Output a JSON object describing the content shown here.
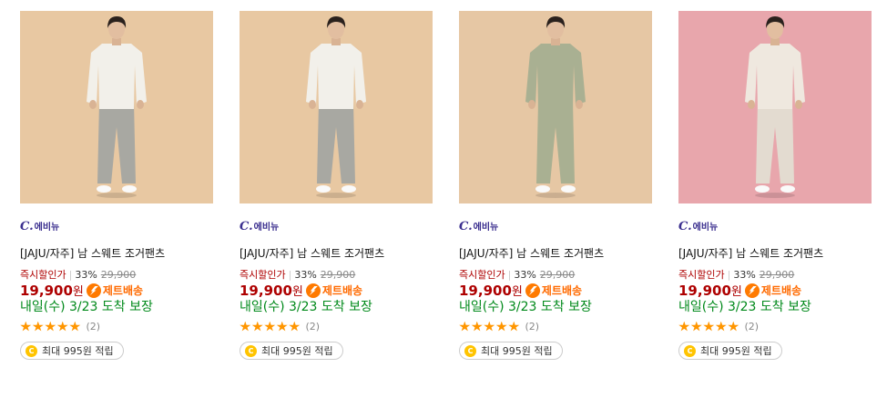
{
  "products": [
    {
      "bg": "#e8c8a2",
      "top_color": "#f2f0ea",
      "pants_color": "#a8a8a2",
      "brand_initial": "C.",
      "brand_name": "에비뉴",
      "title": "[JAJU/자주] 남 스웨트 조거팬츠",
      "discount_label": "즉시할인가",
      "discount_rate": "33%",
      "original_price": "29,900",
      "price": "19,900",
      "currency": "원",
      "shipping_badge": "제트배송",
      "delivery": "내일(수) 3/23 도착 보장",
      "rating": 5,
      "review_count": "(2)",
      "reward": "최대 995원 적립",
      "coin_symbol": "C"
    },
    {
      "bg": "#e8c8a2",
      "top_color": "#f2f0ea",
      "pants_color": "#a8a8a2",
      "brand_initial": "C.",
      "brand_name": "에비뉴",
      "title": "[JAJU/자주] 남 스웨트 조거팬츠",
      "discount_label": "즉시할인가",
      "discount_rate": "33%",
      "original_price": "29,900",
      "price": "19,900",
      "currency": "원",
      "shipping_badge": "제트배송",
      "delivery": "내일(수) 3/23 도착 보장",
      "rating": 5,
      "review_count": "(2)",
      "reward": "최대 995원 적립",
      "coin_symbol": "C"
    },
    {
      "bg": "#e6c7a4",
      "top_color": "#a9b092",
      "pants_color": "#a9b092",
      "brand_initial": "C.",
      "brand_name": "에비뉴",
      "title": "[JAJU/자주] 남 스웨트 조거팬츠",
      "discount_label": "즉시할인가",
      "discount_rate": "33%",
      "original_price": "29,900",
      "price": "19,900",
      "currency": "원",
      "shipping_badge": "제트배송",
      "delivery": "내일(수) 3/23 도착 보장",
      "rating": 5,
      "review_count": "(2)",
      "reward": "최대 995원 적립",
      "coin_symbol": "C"
    },
    {
      "bg": "#e8a6ac",
      "top_color": "#efe8df",
      "pants_color": "#e3dbd0",
      "brand_initial": "C.",
      "brand_name": "에비뉴",
      "title": "[JAJU/자주] 남 스웨트 조거팬츠",
      "discount_label": "즉시할인가",
      "discount_rate": "33%",
      "original_price": "29,900",
      "price": "19,900",
      "currency": "원",
      "shipping_badge": "제트배송",
      "delivery": "내일(수) 3/23 도착 보장",
      "rating": 5,
      "review_count": "(2)",
      "reward": "최대 995원 적립",
      "coin_symbol": "C"
    }
  ]
}
